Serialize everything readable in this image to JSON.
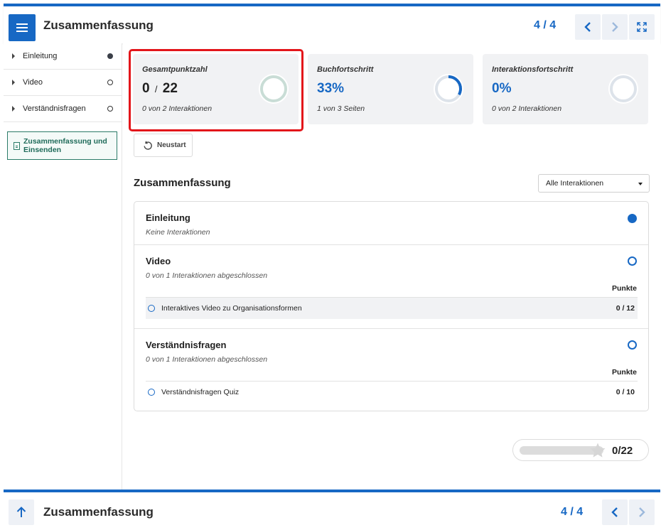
{
  "header": {
    "title": "Zusammenfassung",
    "page_indicator": "4 / 4"
  },
  "sidebar": {
    "items": [
      {
        "label": "Einleitung",
        "status": "filled"
      },
      {
        "label": "Video",
        "status": "empty"
      },
      {
        "label": "Verständnisfragen",
        "status": "empty"
      }
    ],
    "submit_label": "Zusammenfassung und Einsenden"
  },
  "cards": {
    "score": {
      "label": "Gesamtpunktzahl",
      "value_a": "0",
      "value_sep": "/",
      "value_b": "22",
      "sub": "0 von 2 Interaktionen",
      "progress": 0
    },
    "book": {
      "label": "Buchfortschritt",
      "value": "33%",
      "sub": "1 von 3 Seiten",
      "progress": 0.33
    },
    "interaction": {
      "label": "Interaktionsfortschritt",
      "value": "0%",
      "sub": "0 von 2 Interaktionen",
      "progress": 0
    }
  },
  "restart_label": "Neustart",
  "summary": {
    "title": "Zusammenfassung",
    "filter_value": "Alle Interaktionen",
    "sections": [
      {
        "title": "Einleitung",
        "sub": "Keine Interaktionen",
        "status": "filled"
      },
      {
        "title": "Video",
        "sub": "0 von 1 Interaktionen abgeschlossen",
        "status": "empty",
        "points_header": "Punkte",
        "rows": [
          {
            "label": "Interaktives Video zu Organisationsformen",
            "score": "0 / 12"
          }
        ]
      },
      {
        "title": "Verständnisfragen",
        "sub": "0 von 1 Interaktionen abgeschlossen",
        "status": "empty",
        "points_header": "Punkte",
        "rows": [
          {
            "label": "Verständnisfragen Quiz",
            "score": "0 / 10"
          }
        ]
      }
    ]
  },
  "total_score": {
    "value": "0/22",
    "progress": 0
  },
  "footer": {
    "title": "Zusammenfassung",
    "page_indicator": "4 / 4"
  },
  "colors": {
    "accent": "#1768c4",
    "highlight": "#e3151a",
    "ring_score": "#c9ddd6",
    "ring_track": "#dde3ea"
  },
  "icons": [
    "menu-icon",
    "chevron-left-icon",
    "chevron-right-icon",
    "fullscreen-icon",
    "document-icon",
    "restart-icon",
    "star-icon",
    "arrow-up-icon"
  ]
}
